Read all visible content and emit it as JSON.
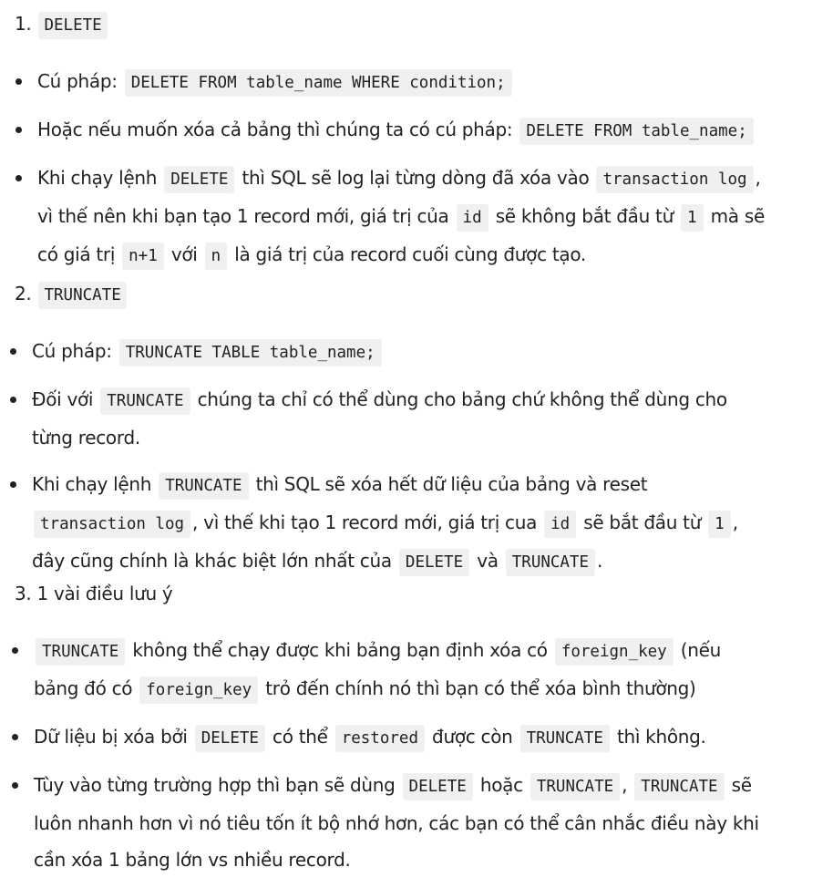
{
  "section1": {
    "number": "1.",
    "code": "DELETE",
    "item1": {
      "pre": "Cú pháp:",
      "code": "DELETE FROM table_name WHERE condition;"
    },
    "item2": {
      "pre": "Hoặc nếu muốn xóa cả bảng thì chúng ta có cú pháp:",
      "code": "DELETE FROM table_name;"
    },
    "item3": {
      "pre": "Khi chạy lệnh",
      "code1": "DELETE",
      "mid1": "thì SQL sẽ log lại từng dòng đã xóa vào",
      "code2": "transaction log",
      "mid2": ",",
      "line2_pre": "vì thế nên khi bạn tạo 1 record mới, giá trị của",
      "code3": "id",
      "mid3": "sẽ không bắt đầu từ",
      "code4": "1",
      "mid4": "mà sẽ",
      "line3_pre": "có giá trị",
      "code5": "n+1",
      "mid5": "với",
      "code6": "n",
      "end": "là giá trị của record cuối cùng được tạo."
    }
  },
  "section2": {
    "number": "2.",
    "code": "TRUNCATE",
    "item1": {
      "pre": "Cú pháp:",
      "code": "TRUNCATE TABLE table_name;"
    },
    "item2": {
      "pre": "Đối với",
      "code": "TRUNCATE",
      "mid": "chúng ta chỉ có thể dùng cho bảng chứ không thể dùng cho",
      "line2": "từng record."
    },
    "item3": {
      "pre": "Khi chạy lệnh",
      "code1": "TRUNCATE",
      "mid1": "thì SQL sẽ xóa hết dữ liệu của bảng và reset",
      "code2": "transaction log",
      "mid2": ", vì thế khi tạo 1 record mới, giá trị cua",
      "code3": "id",
      "mid3": "sẽ bắt đầu từ",
      "code4": "1",
      "mid4": ",",
      "line3_pre": "đây cũng chính là khác biệt lớn nhất của",
      "code5": "DELETE",
      "mid5": "và",
      "code6": "TRUNCATE",
      "end": "."
    }
  },
  "section3": {
    "number": "3.",
    "title": "1 vài điều lưu ý",
    "item1": {
      "code1": "TRUNCATE",
      "mid1": "không thể chạy được khi bảng bạn định xóa có",
      "code2": "foreign_key",
      "mid2": "(nếu",
      "line2_pre": "bảng đó có",
      "code3": "foreign_key",
      "end": "trỏ đến chính nó thì bạn có thể xóa bình thường)"
    },
    "item2": {
      "pre": "Dữ liệu bị xóa bởi",
      "code1": "DELETE",
      "mid1": "có thể",
      "code2": "restored",
      "mid2": "được còn",
      "code3": "TRUNCATE",
      "end": "thì không."
    },
    "item3": {
      "pre": "Tùy vào từng trường hợp thì bạn sẽ dùng",
      "code1": "DELETE",
      "mid1": "hoặc",
      "code2": "TRUNCATE",
      "mid2": ",",
      "code3": "TRUNCATE",
      "mid3": "sẽ",
      "line2": "luôn nhanh hơn vì nó tiêu tốn ít bộ nhớ hơn, các bạn có thể cân nhắc điều này khi",
      "line3": "cần xóa 1 bảng lớn vs nhiều record."
    }
  }
}
